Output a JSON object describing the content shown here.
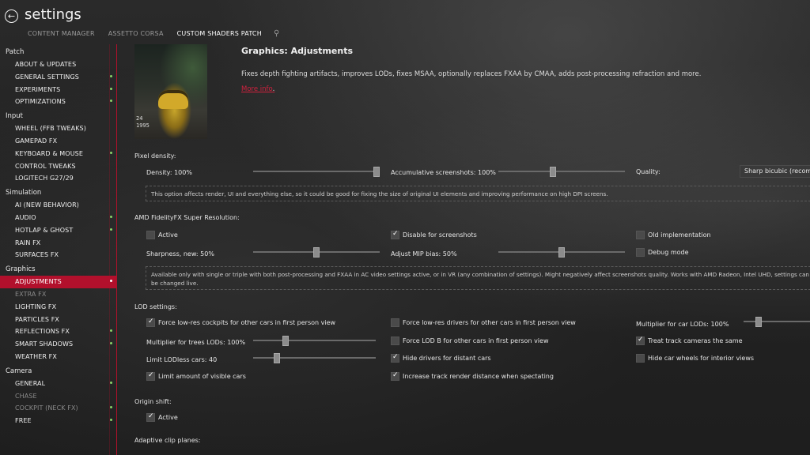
{
  "app": {
    "title": "settings",
    "tabs": [
      "CONTENT MANAGER",
      "ASSETTO CORSA",
      "CUSTOM SHADERS PATCH"
    ],
    "active_tab": 2
  },
  "sidebar": {
    "groups": [
      {
        "label": "Patch",
        "items": [
          {
            "label": "ABOUT & UPDATES",
            "dot": false,
            "dim": false
          },
          {
            "label": "GENERAL SETTINGS",
            "dot": true,
            "dim": false
          },
          {
            "label": "EXPERIMENTS",
            "dot": true,
            "dim": false
          },
          {
            "label": "OPTIMIZATIONS",
            "dot": true,
            "dim": false
          }
        ]
      },
      {
        "label": "Input",
        "items": [
          {
            "label": "WHEEL (FFB TWEAKS)",
            "dot": false,
            "dim": false
          },
          {
            "label": "GAMEPAD FX",
            "dot": false,
            "dim": false
          },
          {
            "label": "KEYBOARD & MOUSE",
            "dot": true,
            "dim": false
          },
          {
            "label": "CONTROL TWEAKS",
            "dot": false,
            "dim": false
          },
          {
            "label": "LOGITECH G27/29",
            "dot": false,
            "dim": false
          }
        ]
      },
      {
        "label": "Simulation",
        "items": [
          {
            "label": "AI (NEW BEHAVIOR)",
            "dot": false,
            "dim": false
          },
          {
            "label": "AUDIO",
            "dot": true,
            "dim": false
          },
          {
            "label": "HOTLAP & GHOST",
            "dot": true,
            "dim": false
          },
          {
            "label": "RAIN FX",
            "dot": false,
            "dim": false
          },
          {
            "label": "SURFACES FX",
            "dot": false,
            "dim": false
          }
        ]
      },
      {
        "label": "Graphics",
        "items": [
          {
            "label": "ADJUSTMENTS",
            "dot": true,
            "dim": false,
            "active": true
          },
          {
            "label": "EXTRA FX",
            "dot": false,
            "dim": true
          },
          {
            "label": "LIGHTING FX",
            "dot": false,
            "dim": false
          },
          {
            "label": "PARTICLES FX",
            "dot": false,
            "dim": false
          },
          {
            "label": "REFLECTIONS FX",
            "dot": true,
            "dim": false
          },
          {
            "label": "SMART SHADOWS",
            "dot": true,
            "dim": false
          },
          {
            "label": "WEATHER FX",
            "dot": false,
            "dim": false
          }
        ]
      },
      {
        "label": "Camera",
        "items": [
          {
            "label": "GENERAL",
            "dot": true,
            "dim": false
          },
          {
            "label": "CHASE",
            "dot": false,
            "dim": true
          },
          {
            "label": "COCKPIT (NECK FX)",
            "dot": true,
            "dim": true
          },
          {
            "label": "FREE",
            "dot": true,
            "dim": false
          }
        ]
      }
    ]
  },
  "header": {
    "title": "Graphics: Adjustments",
    "description": "Fixes depth fighting artifacts, improves LODs, fixes MSAA, optionally replaces FXAA by CMAA, adds post-processing refraction and more.",
    "more_info": "More info",
    "thumb_line1": "24",
    "thumb_line2": "1995"
  },
  "pixel_density": {
    "section": "Pixel density:",
    "density_label": "Density: 100%",
    "density_value": 1.0,
    "accum_label": "Accumulative screenshots: 100%",
    "accum_value": 0.43,
    "quality_label": "Quality:",
    "quality_value": "Sharp bicubic (recommended)",
    "note": "This option affects render, UI and everything else, so it could be good for fixing the size of original UI elements and improving performance on high DPI screens."
  },
  "fsr": {
    "section": "AMD FidelityFX Super Resolution:",
    "active_label": "Active",
    "active": false,
    "disable_screens_label": "Disable for screenshots",
    "disable_screens": true,
    "old_impl_label": "Old implementation",
    "old_impl": false,
    "sharpness_label": "Sharpness, new: 50%",
    "sharpness_value": 0.5,
    "mip_label": "Adjust MIP bias: 50%",
    "mip_value": 0.5,
    "debug_label": "Debug mode",
    "debug": false,
    "note": "Available only with single or triple with both post-processing and FXAA in AC video settings active, or in VR (any combination of settings). Might negatively affect screenshots quality. Works with AMD Radeon, Intel UHD, settings can be changed live."
  },
  "lod": {
    "section": "LOD settings:",
    "force_cockpits_label": "Force low-res cockpits for other cars in first person view",
    "force_cockpits": true,
    "force_drivers_label": "Force low-res drivers for other cars in first person view",
    "force_drivers": false,
    "car_lods_label": "Multiplier for car LODs: 100%",
    "car_lods_value": 0.2,
    "trees_label": "Multiplier for trees LODs: 100%",
    "trees_value": 0.25,
    "force_lodb_label": "Force LOD B for other cars in first person view",
    "force_lodb": false,
    "track_cameras_label": "Treat track cameras the same",
    "track_cameras": true,
    "lodless_label": "Limit LODless cars: 40",
    "lodless_value": 0.18,
    "hide_drivers_label": "Hide drivers for distant cars",
    "hide_drivers": true,
    "hide_wheels_label": "Hide car wheels for interior views",
    "hide_wheels": false,
    "limit_visible_label": "Limit amount of visible cars",
    "limit_visible": true,
    "increase_track_label": "Increase track render distance when spectating",
    "increase_track": true
  },
  "origin_shift": {
    "section": "Origin shift:",
    "active_label": "Active",
    "active": true
  },
  "clip_planes": {
    "section": "Adaptive clip planes:"
  }
}
